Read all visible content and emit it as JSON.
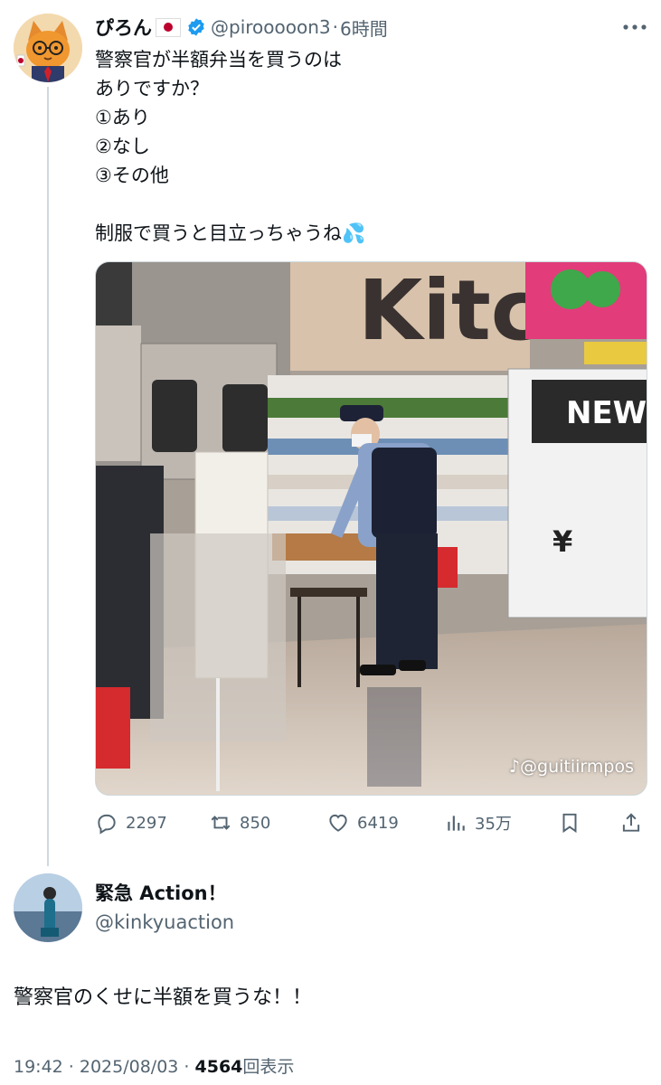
{
  "tweet": {
    "display_name": "ぴろん",
    "flag_icon": "japan-flag-icon",
    "verified_icon": "verified-badge-icon",
    "handle": "@pirooooon3",
    "separator": "·",
    "time": "6時間",
    "lines": [
      "警察官が半額弁当を買うのは",
      "ありですか？",
      "①あり",
      "②なし",
      "③その他",
      "",
      "制服で買うと目立っちゃうね💦"
    ],
    "media": {
      "watermark": "@guitiirmpos",
      "watermark_icon": "tiktok-icon",
      "sign_text": "NEW",
      "shop_text": "Kitc",
      "price_symbol": "¥"
    },
    "actions": {
      "reply_count": "2297",
      "retweet_count": "850",
      "like_count": "6419",
      "views_count": "35万"
    }
  },
  "reply": {
    "display_name": "緊急 Action！",
    "handle": "@kinkyuaction",
    "text": "警察官のくせに半額を買うな！！",
    "timestamp": "19:42 · 2025/08/03 ·",
    "views_count": "4564",
    "views_label": "回表示"
  },
  "colors": {
    "text_primary": "#0f1419",
    "text_secondary": "#536471",
    "verified_blue": "#1d9bf0",
    "thread_line": "#cfd9de"
  }
}
